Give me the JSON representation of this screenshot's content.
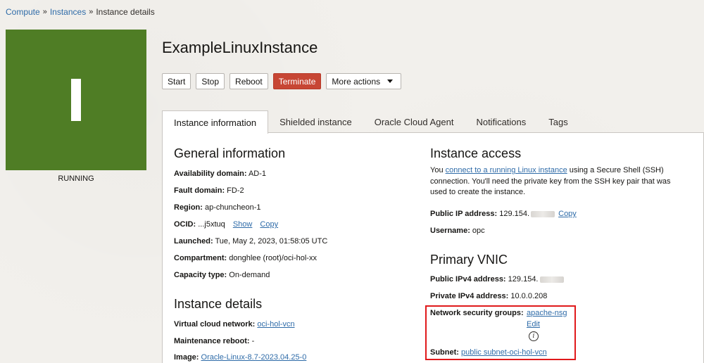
{
  "breadcrumb": {
    "items": [
      {
        "label": "Compute",
        "link": true
      },
      {
        "label": "Instances",
        "link": true
      },
      {
        "label": "Instance details",
        "link": false
      }
    ],
    "separator": "»"
  },
  "instance": {
    "tile_letter": "I",
    "tile_color": "#4f7d25",
    "state": "RUNNING",
    "name": "ExampleLinuxInstance"
  },
  "actions": {
    "start": "Start",
    "stop": "Stop",
    "reboot": "Reboot",
    "terminate": "Terminate",
    "more": "More actions"
  },
  "tabs": [
    {
      "label": "Instance information",
      "active": true
    },
    {
      "label": "Shielded instance",
      "active": false
    },
    {
      "label": "Oracle Cloud Agent",
      "active": false
    },
    {
      "label": "Notifications",
      "active": false
    },
    {
      "label": "Tags",
      "active": false
    }
  ],
  "general": {
    "title": "General information",
    "availability_domain_label": "Availability domain:",
    "availability_domain": "AD-1",
    "fault_domain_label": "Fault domain:",
    "fault_domain": "FD-2",
    "region_label": "Region:",
    "region": "ap-chuncheon-1",
    "ocid_label": "OCID:",
    "ocid": "...j5xtuq",
    "show": "Show",
    "copy": "Copy",
    "launched_label": "Launched:",
    "launched": "Tue, May 2, 2023, 01:58:05 UTC",
    "compartment_label": "Compartment:",
    "compartment": "donghlee (root)/oci-hol-xx",
    "capacity_label": "Capacity type:",
    "capacity": "On-demand"
  },
  "details": {
    "title": "Instance details",
    "vcn_label": "Virtual cloud network:",
    "vcn": "oci-hol-vcn",
    "maintenance_label": "Maintenance reboot:",
    "maintenance": "-",
    "image_label": "Image:",
    "image": "Oracle-Linux-8.7-2023.04.25-0"
  },
  "access": {
    "title": "Instance access",
    "text_before": "You ",
    "link": "connect to a running Linux instance",
    "text_after": " using a Secure Shell (SSH) connection. You'll need the private key from the SSH key pair that was used to create the instance.",
    "public_ip_label": "Public IP address:",
    "public_ip": "129.154.",
    "copy": "Copy",
    "username_label": "Username:",
    "username": "opc"
  },
  "vnic": {
    "title": "Primary VNIC",
    "public_ipv4_label": "Public IPv4 address:",
    "public_ipv4": "129.154.",
    "private_ipv4_label": "Private IPv4 address:",
    "private_ipv4": "10.0.0.208",
    "nsg_label": "Network security groups:",
    "nsg": "apache-nsg",
    "edit": "Edit",
    "info_icon": "i",
    "subnet_label": "Subnet:",
    "subnet": "public subnet-oci-hol-vcn"
  },
  "colors": {
    "accent_link": "#2e6ba8",
    "danger": "#c74634",
    "highlight": "#e0191b"
  }
}
